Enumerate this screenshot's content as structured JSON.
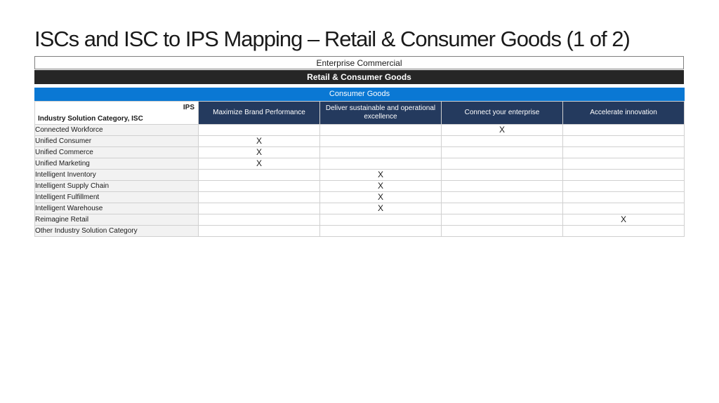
{
  "slide": {
    "title": "ISCs and ISC to IPS Mapping – Retail & Consumer Goods (1 of 2)"
  },
  "bands": {
    "enterprise": "Enterprise Commercial",
    "industry": "Retail & Consumer Goods",
    "subindustry": "Consumer Goods"
  },
  "table": {
    "corner_ips": "IPS",
    "corner_isc": "Industry Solution Category, ISC",
    "columns": [
      "Maximize Brand Performance",
      "Deliver sustainable and operational excellence",
      "Connect your enterprise",
      "Accelerate innovation"
    ],
    "rows": [
      {
        "label": "Connected Workforce",
        "cells": [
          "",
          "",
          "X",
          ""
        ]
      },
      {
        "label": "Unified Consumer",
        "cells": [
          "X",
          "",
          "",
          ""
        ]
      },
      {
        "label": "Unified Commerce",
        "cells": [
          "X",
          "",
          "",
          ""
        ]
      },
      {
        "label": "Unified Marketing",
        "cells": [
          "X",
          "",
          "",
          ""
        ]
      },
      {
        "label": "Intelligent Inventory",
        "cells": [
          "",
          "X",
          "",
          ""
        ]
      },
      {
        "label": "Intelligent Supply Chain",
        "cells": [
          "",
          "X",
          "",
          ""
        ]
      },
      {
        "label": "Intelligent Fulfillment",
        "cells": [
          "",
          "X",
          "",
          ""
        ]
      },
      {
        "label": "Intelligent Warehouse",
        "cells": [
          "",
          "X",
          "",
          ""
        ]
      },
      {
        "label": "Reimagine Retail",
        "cells": [
          "",
          "",
          "",
          "X"
        ]
      },
      {
        "label": "Other Industry Solution Category",
        "cells": [
          "",
          "",
          "",
          ""
        ]
      }
    ]
  },
  "colors": {
    "industry_band": "#262626",
    "subindustry_band": "#0a78d4",
    "column_header": "#243a5e",
    "row_label_bg": "#f2f2f2"
  }
}
